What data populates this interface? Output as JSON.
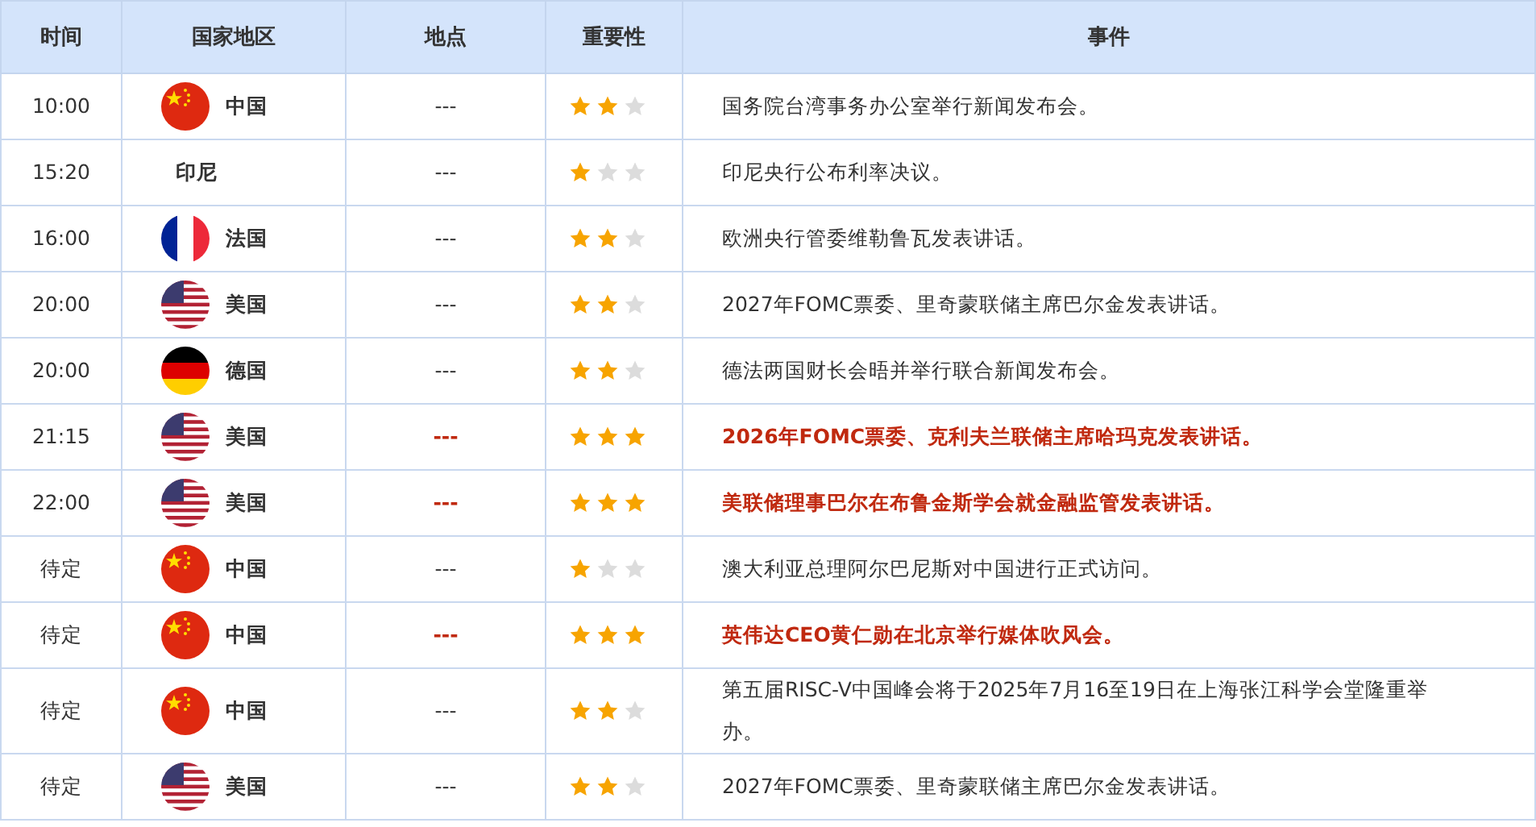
{
  "table": {
    "columns": [
      "时间",
      "国家地区",
      "地点",
      "重要性",
      "事件"
    ],
    "rows": [
      {
        "time": "10:00",
        "kind": "china",
        "country": "中国",
        "location": "---",
        "stars": 2,
        "event": "国务院台湾事务办公室举行新闻发布会。",
        "highlighted": false
      },
      {
        "time": "15:20",
        "kind": "none",
        "country": "印尼",
        "location": "---",
        "stars": 1,
        "event": "印尼央行公布利率决议。",
        "highlighted": false
      },
      {
        "time": "16:00",
        "kind": "france",
        "country": "法国",
        "location": "---",
        "stars": 2,
        "event": "欧洲央行管委维勒鲁瓦发表讲话。",
        "highlighted": false
      },
      {
        "time": "20:00",
        "kind": "usa",
        "country": "美国",
        "location": "---",
        "stars": 2,
        "event": "2027年FOMC票委、里奇蒙联储主席巴尔金发表讲话。",
        "highlighted": false
      },
      {
        "time": "20:00",
        "kind": "germany",
        "country": "德国",
        "location": "---",
        "stars": 2,
        "event": "德法两国财长会晤并举行联合新闻发布会。",
        "highlighted": false
      },
      {
        "time": "21:15",
        "kind": "usa",
        "country": "美国",
        "location": "---",
        "stars": 3,
        "event": "2026年FOMC票委、克利夫兰联储主席哈玛克发表讲话。",
        "highlighted": true
      },
      {
        "time": "22:00",
        "kind": "usa",
        "country": "美国",
        "location": "---",
        "stars": 3,
        "event": "美联储理事巴尔在布鲁金斯学会就金融监管发表讲话。",
        "highlighted": true
      },
      {
        "time": "待定",
        "kind": "china",
        "country": "中国",
        "location": "---",
        "stars": 1,
        "event": "澳大利亚总理阿尔巴尼斯对中国进行正式访问。",
        "highlighted": false
      },
      {
        "time": "待定",
        "kind": "china",
        "country": "中国",
        "location": "---",
        "stars": 3,
        "event": "英伟达CEO黄仁勋在北京举行媒体吹风会。",
        "highlighted": true
      },
      {
        "time": "待定",
        "kind": "china",
        "country": "中国",
        "location": "---",
        "stars": 2,
        "event": "第五届RISC-V中国峰会将于2025年7月16至19日在上海张江科学会堂隆重举办。",
        "highlighted": false
      },
      {
        "time": "待定",
        "kind": "usa",
        "country": "美国",
        "location": "---",
        "stars": 2,
        "event": "2027年FOMC票委、里奇蒙联储主席巴尔金发表讲话。",
        "highlighted": false
      }
    ]
  }
}
